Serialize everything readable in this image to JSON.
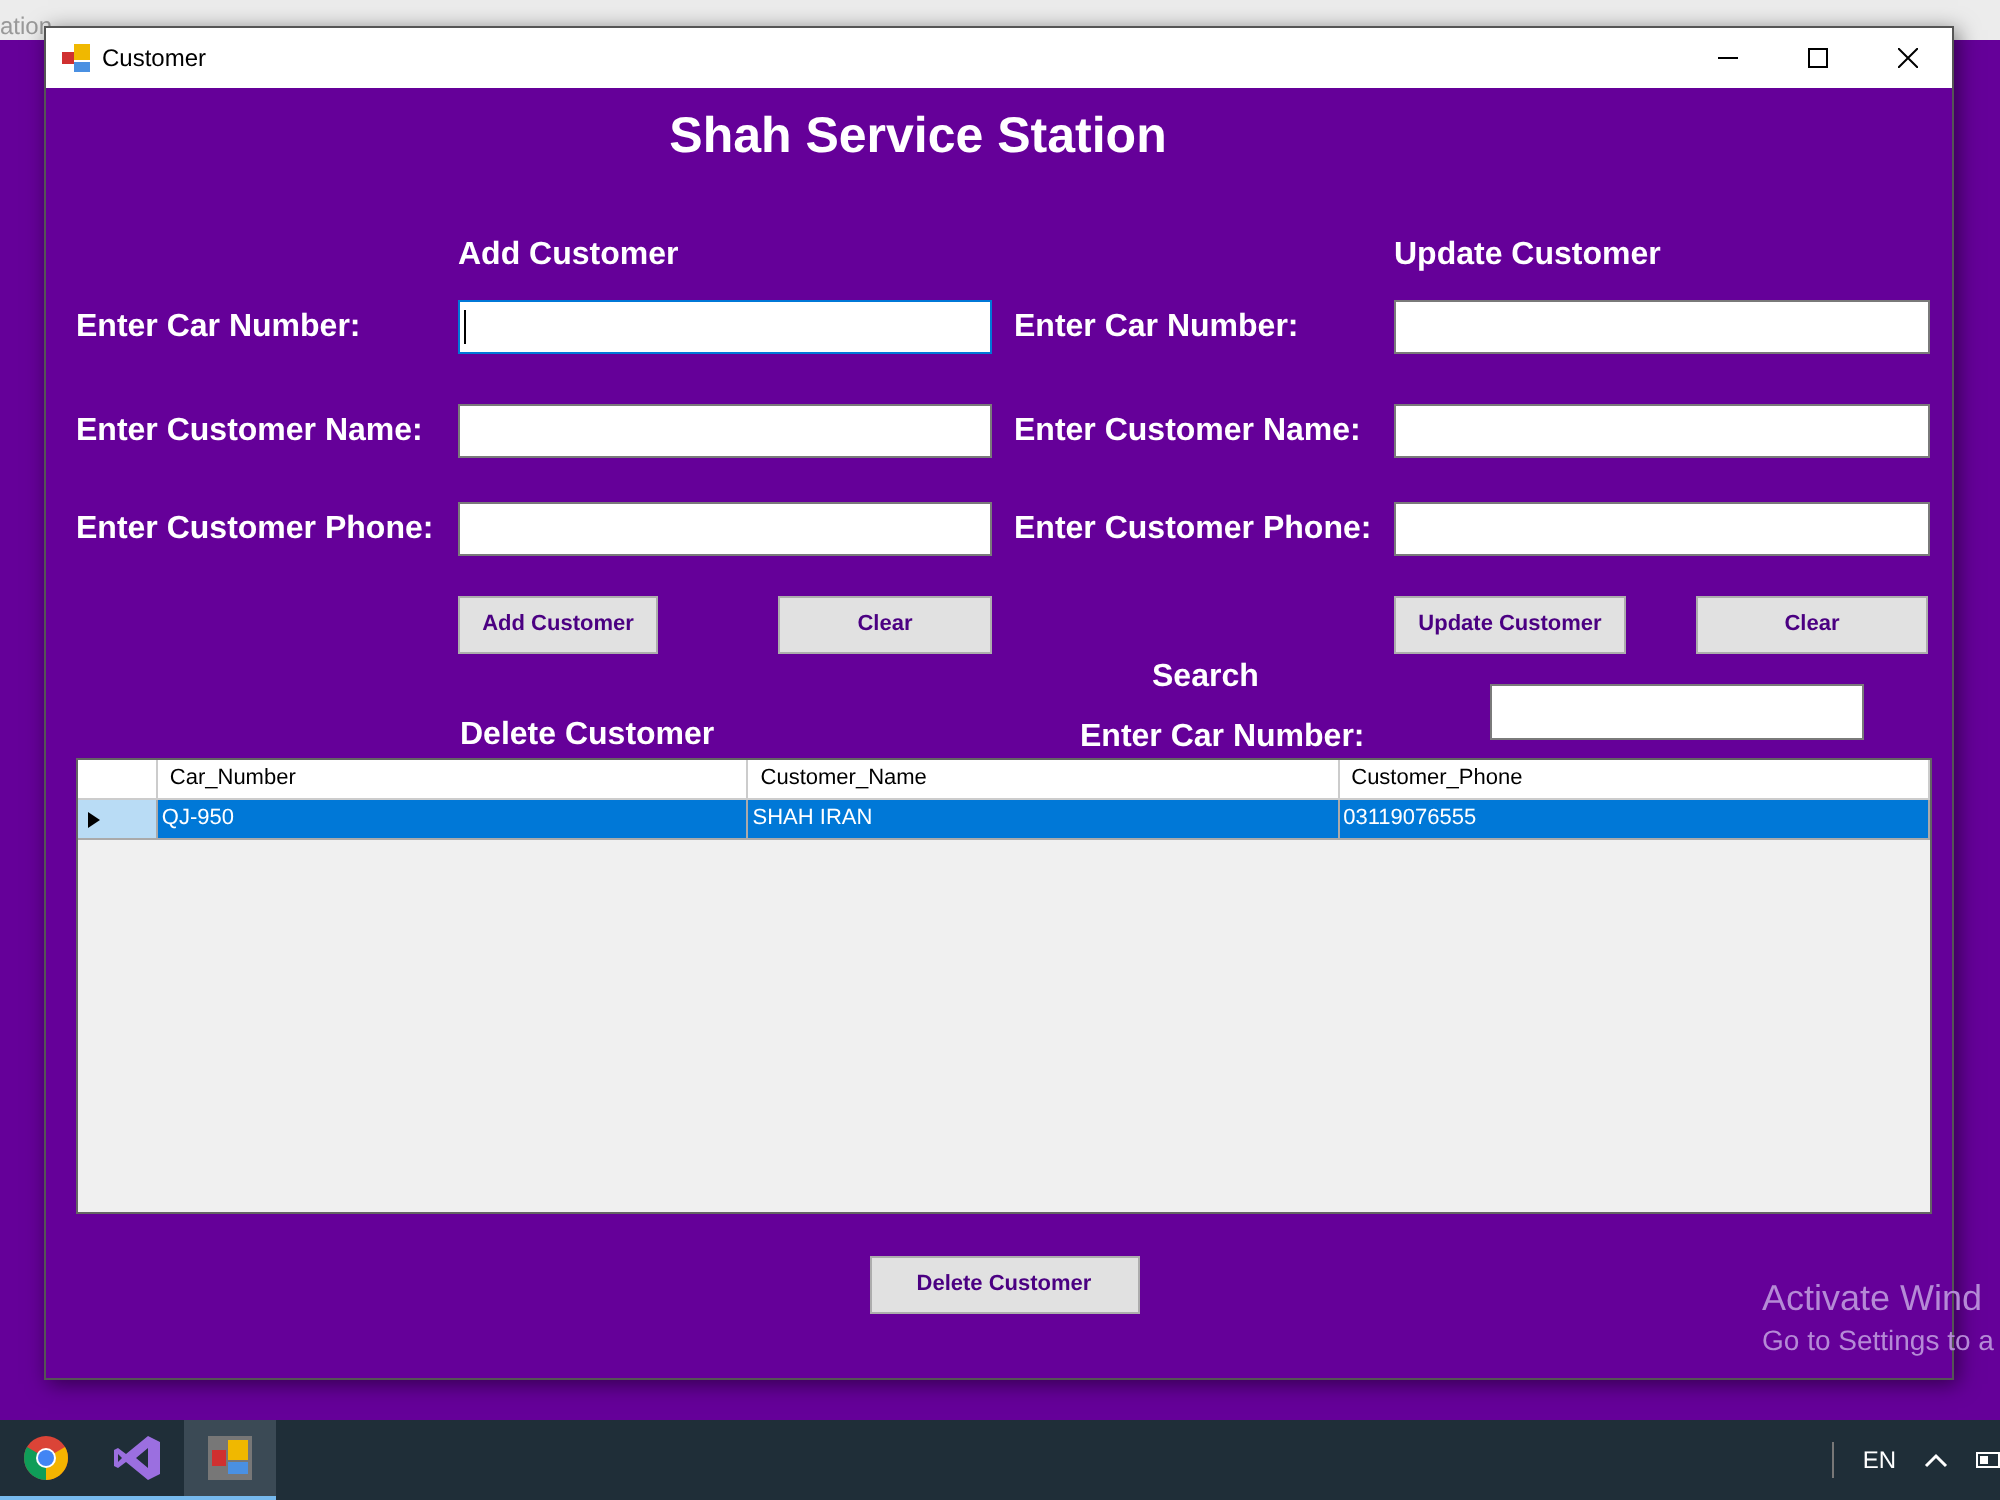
{
  "background_window": {
    "title_fragment": "ation"
  },
  "window": {
    "title": "Customer"
  },
  "form": {
    "title": "Shah Service Station",
    "add_section": {
      "heading": "Add Customer",
      "fields": [
        {
          "label": "Enter Car Number:",
          "focused": true
        },
        {
          "label": "Enter Customer Name:",
          "focused": false
        },
        {
          "label": "Enter Customer Phone:",
          "focused": false
        }
      ],
      "buttons": [
        "Add Customer",
        "Clear"
      ]
    },
    "update_section": {
      "heading": "Update Customer",
      "fields": [
        {
          "label": "Enter Car Number:",
          "focused": false
        },
        {
          "label": "Enter Customer Name:",
          "focused": false
        },
        {
          "label": "Enter Customer Phone:",
          "focused": false
        }
      ],
      "buttons": [
        "Update Customer",
        "Clear"
      ]
    },
    "search": {
      "heading": "Search",
      "label": "Enter Car Number:"
    },
    "delete_section": {
      "heading": "Delete Customer",
      "button": "Delete Customer"
    },
    "table": {
      "columns": [
        "Car_Number",
        "Customer_Name",
        "Customer_Phone"
      ],
      "rows": [
        {
          "cells": [
            "QJ-950",
            "SHAH IRAN",
            "03119076555"
          ],
          "selected": true
        }
      ]
    }
  },
  "activation_notice": {
    "title": "Activate Wind",
    "subtitle": "Go to Settings to a"
  },
  "taskbar": {
    "apps": [
      {
        "kind": "browser",
        "active": false
      },
      {
        "kind": "ide",
        "active": false
      },
      {
        "kind": "app",
        "active": true
      }
    ],
    "language": "EN"
  }
}
